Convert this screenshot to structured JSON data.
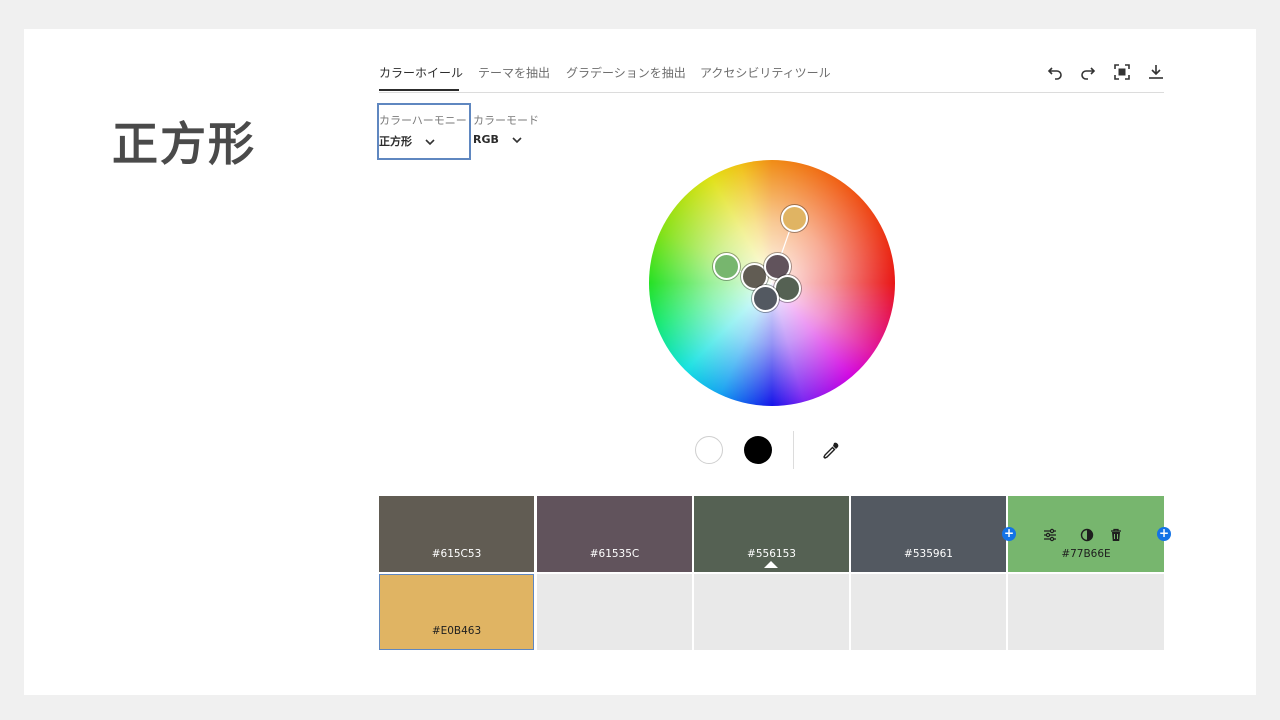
{
  "slide": {
    "title": "正方形"
  },
  "tabs": [
    {
      "label": "カラーホイール",
      "active": true
    },
    {
      "label": "テーマを抽出"
    },
    {
      "label": "グラデーションを抽出"
    },
    {
      "label": "アクセシビリティツール"
    }
  ],
  "toolbar": {
    "icons": [
      "undo-icon",
      "redo-icon",
      "fullscreen-icon",
      "download-icon"
    ]
  },
  "harmony": {
    "label": "カラーハーモニー",
    "value": "正方形"
  },
  "color_mode": {
    "label": "カラーモード",
    "value": "RGB"
  },
  "wheel_handles": [
    "#E0B463",
    "#77B66E",
    "#615C53",
    "#61535C",
    "#556153",
    "#535961"
  ],
  "base_swatches": {
    "white": "#FFFFFF",
    "black": "#000000"
  },
  "swatches": [
    {
      "hex": "#615C53",
      "color": "#615C53"
    },
    {
      "hex": "#61535C",
      "color": "#61535C"
    },
    {
      "hex": "#556153",
      "color": "#556153"
    },
    {
      "hex": "#535961",
      "color": "#535961"
    },
    {
      "hex": "#77B66E",
      "color": "#77B66E"
    },
    {
      "hex": "#E0B463",
      "color": "#E0B463"
    }
  ],
  "colors": {
    "accent": "#1473E6",
    "highlight_border": "#5F87C0"
  }
}
